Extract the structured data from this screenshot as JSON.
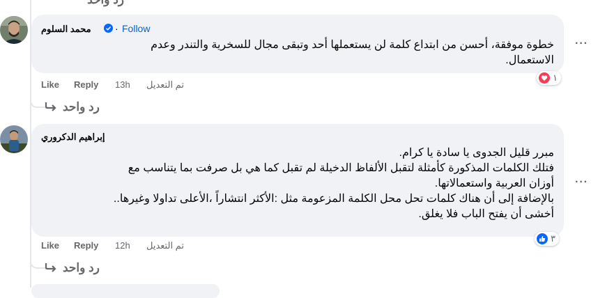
{
  "top_reply": {
    "label": "رد واحد"
  },
  "comments": [
    {
      "author": "محمد السلوم",
      "verified": true,
      "follow_label": "Follow",
      "lines": [
        "خطوة موفقة، أحسن من ابتداع كلمة لن يستعملها أحد وتبقى مجال للسخرية والتندر وعدم",
        "الاستعمال."
      ],
      "like_label": "Like",
      "reply_label": "Reply",
      "time": "13h",
      "edited_label": "تم التعديل",
      "reaction": {
        "icon": "love-icon",
        "count": "١",
        "color": "#f33e58"
      },
      "replies_label": "رد واحد"
    },
    {
      "author": "إبراهيم الدكروري",
      "verified": false,
      "lines": [
        "مبرر قليل الجدوى يا سادة يا كرام.",
        "فتلك الكلمات المذكورة كأمثلة لتقبل الألفاظ الدخيلة لم تقبل كما هي بل صرفت بما يتناسب مع",
        "أوزان العربية واستعمالاتها.",
        "بالإضافة إلى أن هناك كلمات تحل محل الكلمة المزعومة مثل :الأكثر انتشاراً ،الأعلى تداولا وغيرها..",
        "أخشى أن يفتح الباب فلا يغلق."
      ],
      "like_label": "Like",
      "reply_label": "Reply",
      "time": "12h",
      "edited_label": "تم التعديل",
      "reaction": {
        "icon": "like-icon",
        "count": "٣",
        "color": "#0866ff"
      },
      "replies_label": "رد واحد"
    }
  ],
  "more_icon": "more-options-icon"
}
